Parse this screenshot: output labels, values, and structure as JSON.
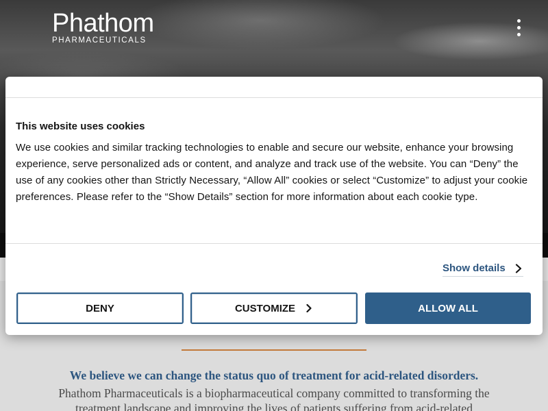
{
  "site": {
    "logo_name": "Phathom",
    "logo_sub": "PHARMACEUTICALS"
  },
  "icons": {
    "menu": "kebab-menu-icon",
    "show_details": "chevron-right-icon",
    "customize": "chevron-right-icon"
  },
  "colors": {
    "brand_blue": "#2f5f8a",
    "link_blue": "#2c557f",
    "accent_orange": "#c47a3a"
  },
  "cookie_dialog": {
    "title": "This website uses cookies",
    "body": "We use cookies and similar tracking technologies to enable and secure our website, enhance your browsing experience, serve personalized ads or content, and analyze and track use of the website. You can “Deny” the use of any cookies other than Strictly Necessary, “Allow All” cookies or select “Customize” to adjust your cookie preferences. Please refer to the “Show Details” section for more information about each cookie type.",
    "show_details_label": "Show details",
    "deny_label": "DENY",
    "customize_label": "CUSTOMIZE",
    "allow_all_label": "ALLOW ALL"
  },
  "mission": {
    "title": "We believe we can change the status quo of treatment for acid-related disorders.",
    "body": "Phathom Pharmaceuticals is a biopharmaceutical company committed to transforming the treatment landscape and improving the lives of patients suffering from acid-related"
  }
}
